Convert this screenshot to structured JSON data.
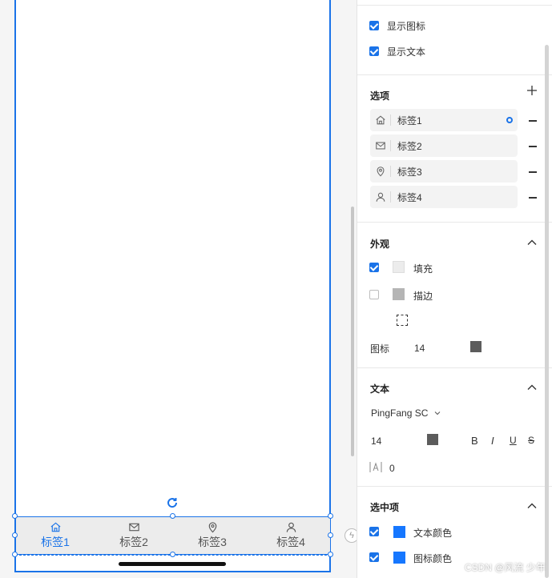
{
  "canvas": {
    "tabs": [
      {
        "label": "标签1",
        "icon": "home-icon",
        "active": true
      },
      {
        "label": "标签2",
        "icon": "mail-icon",
        "active": false
      },
      {
        "label": "标签3",
        "icon": "location-icon",
        "active": false
      },
      {
        "label": "标签4",
        "icon": "user-icon",
        "active": false
      }
    ]
  },
  "panel": {
    "display": {
      "show_icon_label": "显示图标",
      "show_text_label": "显示文本",
      "show_icon": true,
      "show_text": true
    },
    "options": {
      "title": "选项",
      "items": [
        {
          "label": "标签1",
          "icon": "home-icon",
          "selected": true
        },
        {
          "label": "标签2",
          "icon": "mail-icon",
          "selected": false
        },
        {
          "label": "标签3",
          "icon": "location-icon",
          "selected": false
        },
        {
          "label": "标签4",
          "icon": "user-icon",
          "selected": false
        }
      ]
    },
    "appearance": {
      "title": "外观",
      "fill_label": "填充",
      "fill_checked": true,
      "fill_color": "#ececec",
      "stroke_label": "描边",
      "stroke_checked": false,
      "stroke_color": "#b5b5b5",
      "icon_label": "图标",
      "icon_size": "14",
      "icon_color": "#5c5c5c"
    },
    "text": {
      "title": "文本",
      "font": "PingFang SC",
      "size": "14",
      "color": "#5c5c5c",
      "bold": "B",
      "italic": "I",
      "underline": "U",
      "strike": "S",
      "spacing": "0"
    },
    "selected": {
      "title": "选中项",
      "text_color_label": "文本颜色",
      "icon_color_label": "图标颜色",
      "text_color_checked": true,
      "icon_color_checked": true,
      "accent": "#1677ff"
    }
  },
  "watermark": "CSDN @风流 少年",
  "colors": {
    "accent": "#1a73e8"
  }
}
